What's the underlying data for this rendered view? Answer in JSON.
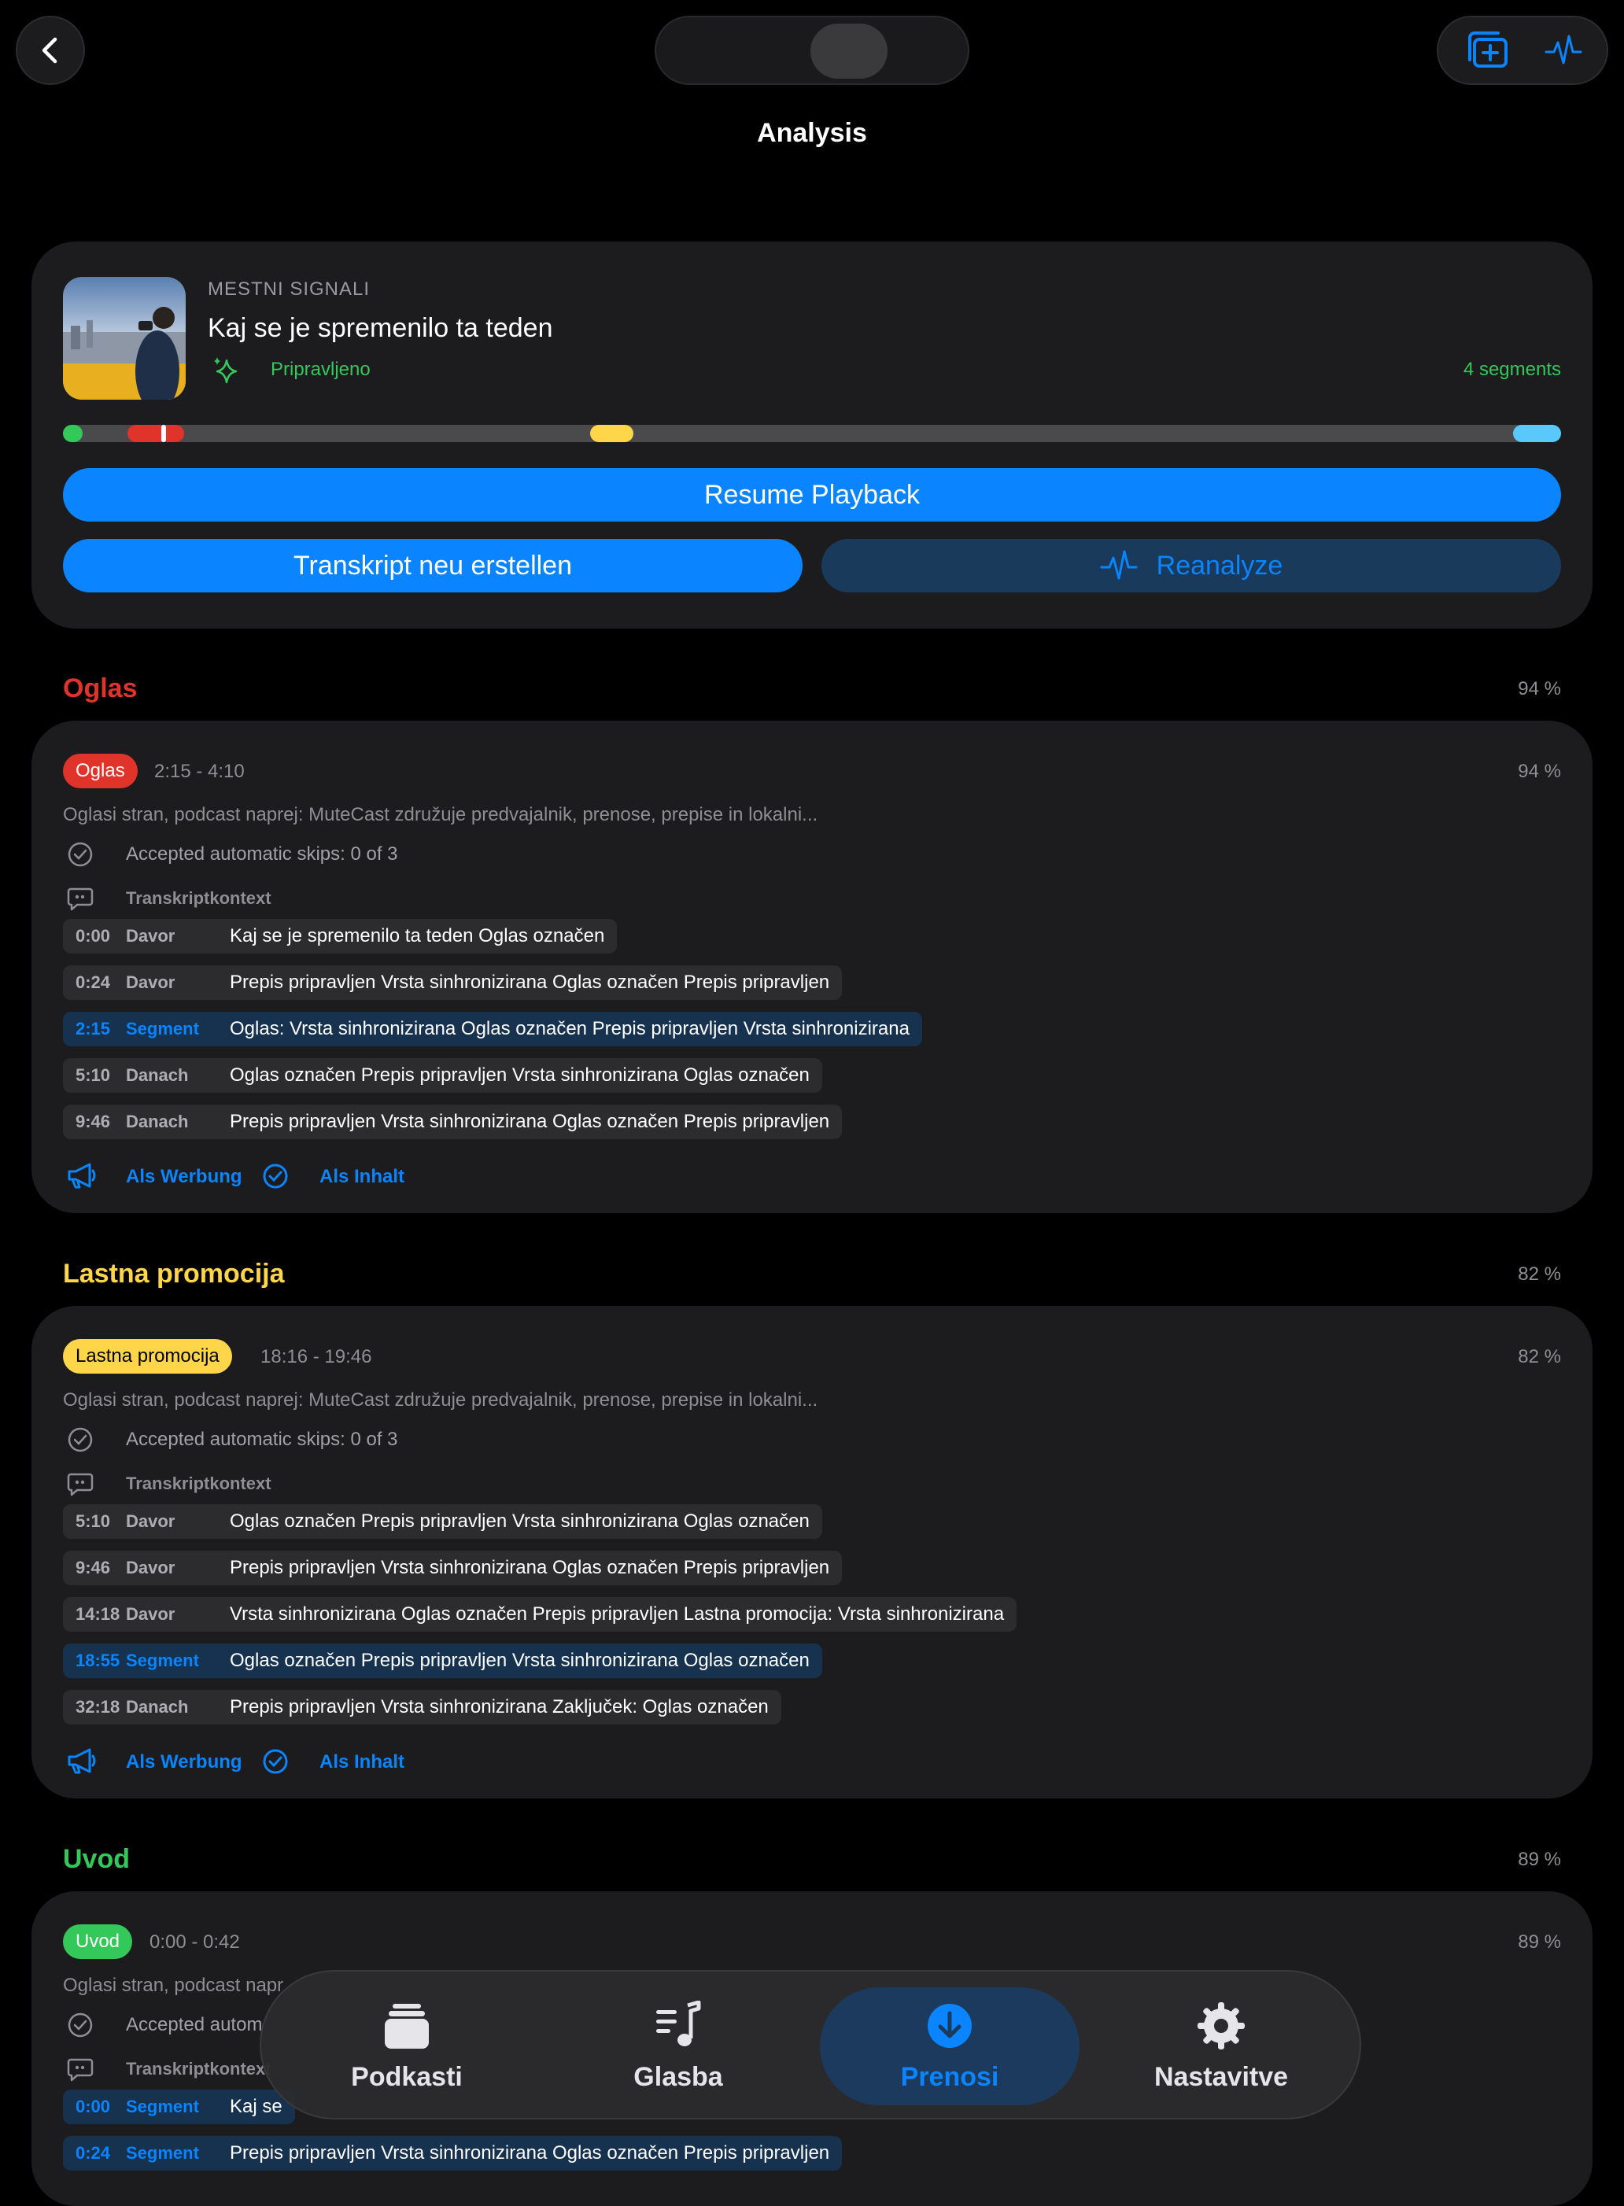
{
  "nav": {
    "title": "Analysis"
  },
  "header": {
    "podcast": "MESTNI SIGNALI",
    "episode": "Kaj se je spremenilo ta teden",
    "status": "Pripravljeno",
    "segments": "4 segments",
    "resume": "Resume Playback",
    "transcribe": "Transkript neu erstellen",
    "reanalyze": "Reanalyze"
  },
  "colors": {
    "accent": "#0a84ff",
    "ad": "#e0342b",
    "promo": "#ffd54a",
    "intro": "#34c759",
    "outro": "#5ac8fa"
  },
  "timeline": [
    {
      "type": "intro",
      "start": 0,
      "end": 0.013
    },
    {
      "type": "ad",
      "start": 0.043,
      "end": 0.081
    },
    {
      "type": "promo",
      "start": 0.352,
      "end": 0.381
    },
    {
      "type": "outro",
      "start": 0.968,
      "end": 1.0
    }
  ],
  "playhead": 0.067,
  "sections": [
    {
      "title": "Oglas",
      "pct": "94 %",
      "badge": "Oglas",
      "range": "2:15 - 4:10",
      "card_pct": "94 %",
      "desc": "Oglasi stran, podcast naprej: MuteCast združuje predvajalnik, prenose, prepise in lokalni...",
      "skips": "Accepted automatic skips: 0 of 3",
      "context": "Transkriptkontext",
      "rows": [
        {
          "time": "0:00",
          "speaker": "Davor",
          "text": "Kaj se je spremenilo ta teden Oglas označen"
        },
        {
          "time": "0:24",
          "speaker": "Davor",
          "text": "Prepis pripravljen Vrsta sinhronizirana Oglas označen Prepis pripravljen"
        },
        {
          "time": "2:15",
          "speaker": "Segment",
          "text": "Oglas: Vrsta sinhronizirana Oglas označen Prepis pripravljen Vrsta sinhronizirana"
        },
        {
          "time": "5:10",
          "speaker": "Danach",
          "text": "Oglas označen Prepis pripravljen Vrsta sinhronizirana Oglas označen"
        },
        {
          "time": "9:46",
          "speaker": "Danach",
          "text": "Prepis pripravljen Vrsta sinhronizirana Oglas označen Prepis pripravljen"
        }
      ],
      "as_ad": "Als Werbung",
      "as_content": "Als Inhalt"
    },
    {
      "title": "Lastna promocija",
      "pct": "82 %",
      "badge": "Lastna promocija",
      "range": "18:16 - 19:46",
      "card_pct": "82 %",
      "desc": "Oglasi stran, podcast naprej: MuteCast združuje predvajalnik, prenose, prepise in lokalni...",
      "skips": "Accepted automatic skips: 0 of 3",
      "context": "Transkriptkontext",
      "rows": [
        {
          "time": "5:10",
          "speaker": "Davor",
          "text": "Oglas označen Prepis pripravljen Vrsta sinhronizirana Oglas označen"
        },
        {
          "time": "9:46",
          "speaker": "Davor",
          "text": "Prepis pripravljen Vrsta sinhronizirana Oglas označen Prepis pripravljen"
        },
        {
          "time": "14:18",
          "speaker": "Davor",
          "text": "Vrsta sinhronizirana Oglas označen Prepis pripravljen Lastna promocija: Vrsta sinhronizirana"
        },
        {
          "time": "18:55",
          "speaker": "Segment",
          "text": "Oglas označen Prepis pripravljen Vrsta sinhronizirana Oglas označen"
        },
        {
          "time": "32:18",
          "speaker": "Danach",
          "text": "Prepis pripravljen Vrsta sinhronizirana Zaključek: Oglas označen"
        }
      ],
      "as_ad": "Als Werbung",
      "as_content": "Als Inhalt"
    },
    {
      "title": "Uvod",
      "pct": "89 %",
      "badge": "Uvod",
      "range": "0:00 - 0:42",
      "card_pct": "89 %",
      "desc": "Oglasi stran, podcast napr",
      "skips": "Accepted autom",
      "context": "Transkriptkontext",
      "rows": [
        {
          "time": "0:00",
          "speaker": "Segment",
          "text": "Kaj se"
        },
        {
          "time": "0:24",
          "speaker": "Segment",
          "text": "Prepis pripravljen Vrsta sinhronizirana Oglas označen Prepis pripravljen"
        }
      ]
    }
  ],
  "tabs": [
    {
      "label": "Podkasti",
      "icon": "stack-icon"
    },
    {
      "label": "Glasba",
      "icon": "music-list-icon"
    },
    {
      "label": "Prenosi",
      "icon": "download-icon"
    },
    {
      "label": "Nastavitve",
      "icon": "gear-icon"
    }
  ]
}
